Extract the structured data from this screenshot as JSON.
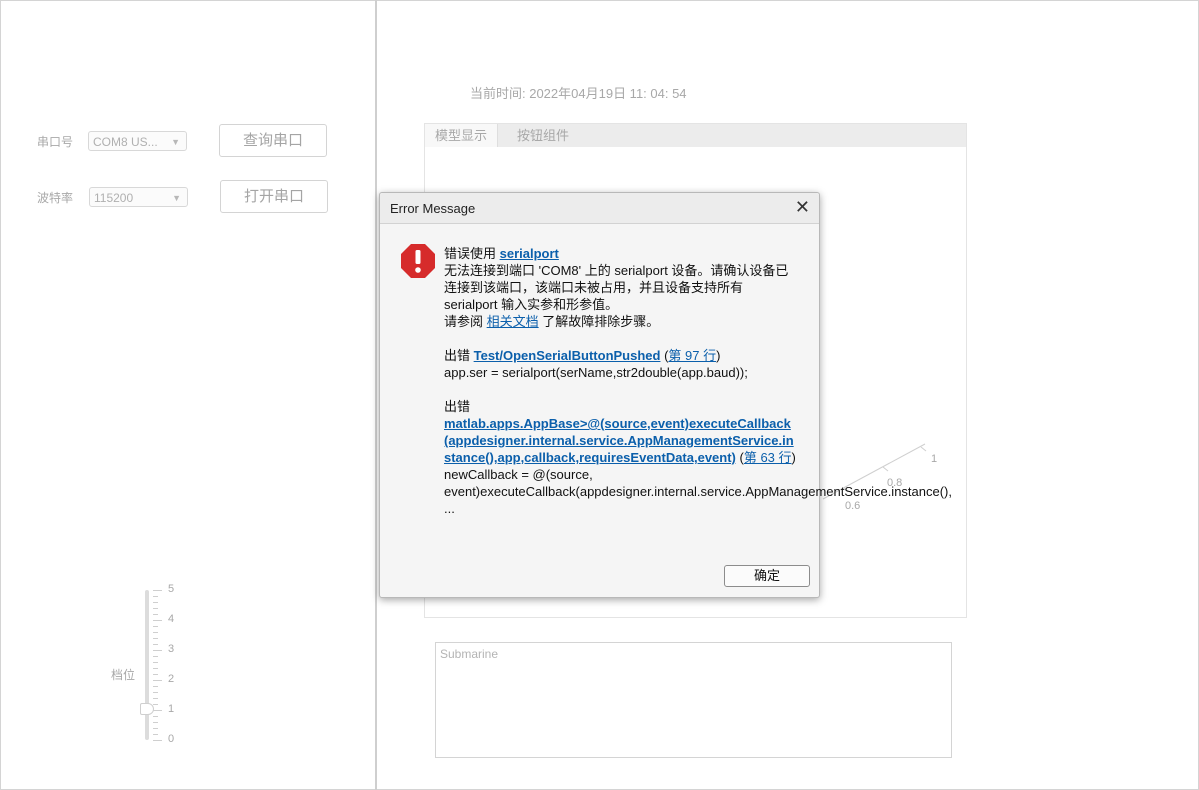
{
  "left_panel": {
    "port_label": "串口号",
    "port_value": "COM8 US...",
    "query_button": "查询串口",
    "baud_label": "波特率",
    "baud_value": "115200",
    "open_button": "打开串口",
    "gear_label": "档位",
    "gear_ticks": [
      "5",
      "4",
      "3",
      "2",
      "1",
      "0"
    ],
    "gear_value": 1
  },
  "right_panel": {
    "time_text": "当前时间: 2022年04月19日 11: 04: 54",
    "tabs": [
      {
        "label": "模型显示"
      },
      {
        "label": "按钮组件"
      }
    ],
    "axis_ticks": [
      "1",
      "0.8",
      "0.6"
    ],
    "textarea_text": "Submarine"
  },
  "dialog": {
    "title": "Error Message",
    "close_glyph": "✕",
    "icon": "error-octagon-icon",
    "line1_prefix": "错误使用 ",
    "line1_link": "serialport",
    "para1": "无法连接到端口 'COM8' 上的 serialport 设备。请确认设备已连接到该端口，该端口未被占用，并且设备支持所有 serialport 输入实参和形参值。",
    "see_prefix": "请参阅 ",
    "see_link": "相关文档",
    "see_suffix": " 了解故障排除步骤。",
    "err1_prefix": "出错 ",
    "err1_link": "Test/OpenSerialButtonPushed",
    "err1_open": " (",
    "err1_line_link": "第 97 行",
    "err1_close": ")",
    "err1_code": "app.ser = serialport(serName,str2double(app.baud));",
    "err2_prefix": "出错",
    "err2_link": "matlab.apps.AppBase>@(source,event)executeCallback(appdesigner.internal.service.AppManagementService.instance(),app,callback,requiresEventData,event)",
    "err2_open": " (",
    "err2_line_link": "第 63 行",
    "err2_close": ")",
    "err2_code": "newCallback = @(source, event)executeCallback(appdesigner.internal.service.AppManagementService.instance(), ...",
    "ok_button": "确定",
    "error_color": "#d62b2b",
    "link_color": "#0b5fab"
  }
}
